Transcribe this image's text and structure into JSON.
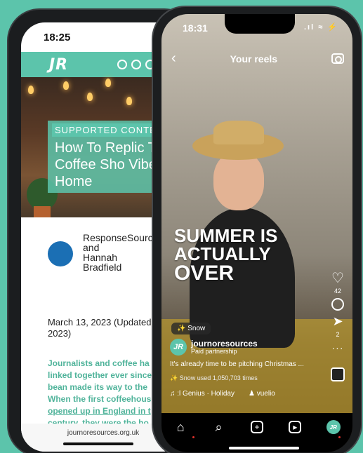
{
  "background_color": "#5cc4ab",
  "back_phone": {
    "time": "18:25",
    "logo": "JR",
    "social_icons": [
      "instagram-icon",
      "twitter-icon",
      "tiktok-icon",
      "other-icon"
    ],
    "hero_kicker": "SUPPORTED CONTEN",
    "hero_title": "How To Replic The Coffee Sho Vibe At Home",
    "author_line1": "ResponseSource",
    "author_line2": "and",
    "author_line3": "Hannah",
    "author_line4": "Bradfield",
    "date": "March 13, 2023 (Updated M 2023)",
    "excerpt_lines": [
      "Journalists and coffee ha",
      "linked together ever since",
      "bean made its way to the",
      "When the first coffeehous",
      "opened up in England in t",
      "century, they were the ho"
    ],
    "url": "journoresources.org.uk"
  },
  "front_phone": {
    "time": "18:31",
    "status_icons": ".ıl ≈ ⚡",
    "title": "Your reels",
    "overlay_line1": "SUMMER IS",
    "overlay_line2": "ACTUALLY",
    "overlay_line3": "OVER",
    "snow_tag": "✨ Snow",
    "account_name": "journoresources",
    "account_sub": "Paid partnership",
    "avatar_text": "JR",
    "caption": "It's already time to be pitching Christmas ...",
    "snow_used": "✨ Snow used 1,050,703 times",
    "audio_label": "♫ :l Genius · Holiday",
    "audio_user": "♟ vuelio",
    "like_count": "42",
    "share_count": "2"
  }
}
